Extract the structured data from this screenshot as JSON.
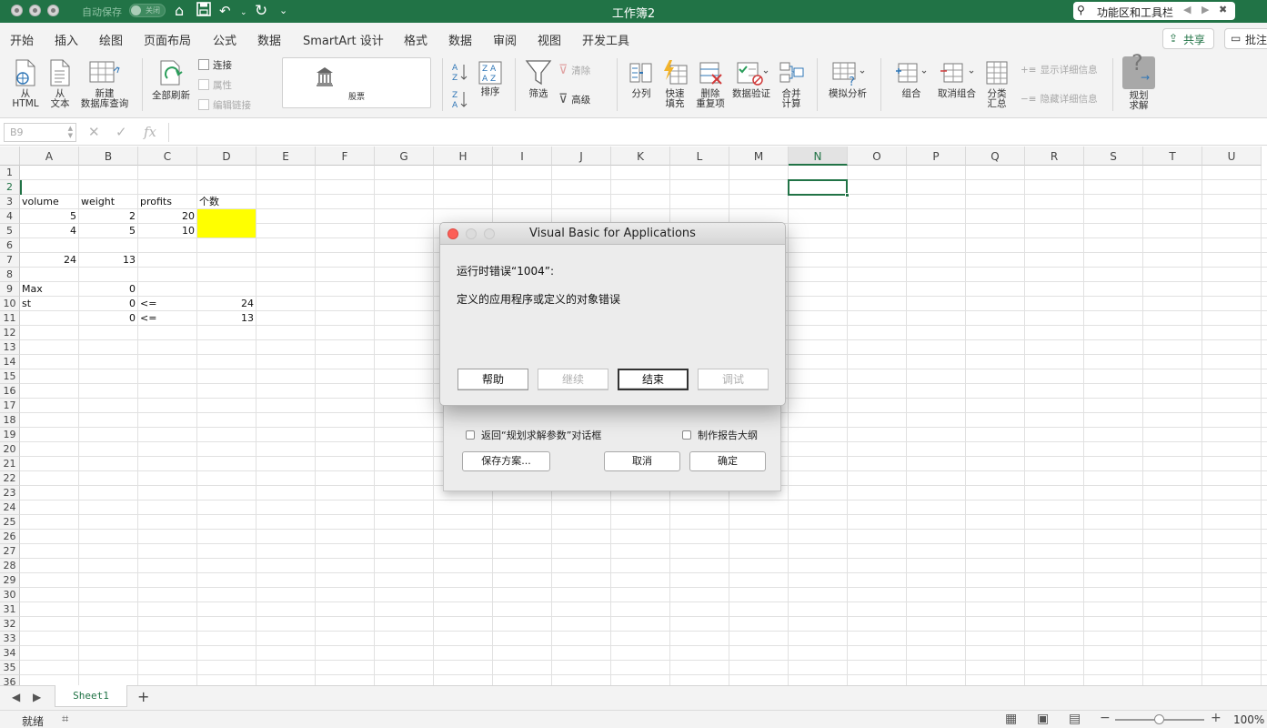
{
  "titlebar": {
    "autosave_label": "自动保存",
    "autosave_state": "关闭",
    "title": "工作簿2",
    "search_query": "功能区和工具栏"
  },
  "ribbon_tabs": [
    "开始",
    "插入",
    "绘图",
    "页面布局",
    "公式",
    "数据",
    "SmartArt 设计",
    "格式",
    "数据",
    "审阅",
    "视图",
    "开发工具"
  ],
  "active_tab_index": 5,
  "header_buttons": {
    "share": "共享",
    "comment": "批注"
  },
  "ribbon": {
    "from_html": [
      "从",
      "HTML"
    ],
    "from_text": [
      "从",
      "文本"
    ],
    "new_query": [
      "新建",
      "数据库查询"
    ],
    "refresh_all": "全部刷新",
    "connections": "连接",
    "properties": "属性",
    "edit_links": "编辑链接",
    "stocks": "股票",
    "sort": "排序",
    "filter": "筛选",
    "clear": "清除",
    "advanced": "高级",
    "text_to_columns": "分列",
    "flash_fill": [
      "快速",
      "填充"
    ],
    "remove_duplicates": [
      "删除",
      "重复项"
    ],
    "data_validation": "数据验证",
    "consolidate": [
      "合并",
      "计算"
    ],
    "what_if": "模拟分析",
    "group": "组合",
    "ungroup": "取消组合",
    "subtotal": [
      "分类",
      "汇总"
    ],
    "show_detail": "显示详细信息",
    "hide_detail": "隐藏详细信息",
    "solver": [
      "规划",
      "求解"
    ]
  },
  "formula_bar": {
    "name_box": "B9",
    "fx": "fx",
    "content": ""
  },
  "columns": [
    "A",
    "B",
    "C",
    "D",
    "E",
    "F",
    "G",
    "H",
    "I",
    "J",
    "K",
    "L",
    "M",
    "N",
    "O",
    "P",
    "Q",
    "R",
    "S",
    "T",
    "U"
  ],
  "selected_column": "N",
  "rows": [
    "1",
    "2",
    "3",
    "4",
    "5",
    "6",
    "7",
    "8",
    "9",
    "10",
    "11",
    "12",
    "13",
    "14",
    "15",
    "16",
    "17",
    "18",
    "19",
    "20",
    "21",
    "22",
    "23",
    "24",
    "25",
    "26",
    "27",
    "28",
    "29",
    "30",
    "31",
    "32",
    "33",
    "34",
    "35",
    "36"
  ],
  "selected_row": "2",
  "cells": {
    "A3": "volume",
    "B3": "weight",
    "C3": "profits",
    "D3": "个数",
    "A4": "5",
    "B4": "2",
    "C4": "20",
    "A5": "4",
    "B5": "5",
    "C5": "10",
    "A7": "24",
    "B7": "13",
    "A9": "Max",
    "B9": "0",
    "A10": "st",
    "B10": "0",
    "C10": "<=",
    "D10": "24",
    "B11": "0",
    "C11": "<=",
    "D11": "13"
  },
  "highlight_color": "#ffff00",
  "accent_color": "#217346",
  "sheet_tabs": [
    "Sheet1"
  ],
  "status": {
    "mode": "就绪",
    "zoom": "100%"
  },
  "solver_dialog": {
    "return_checkbox": "返回“规划求解参数”对话框",
    "outline_checkbox": "制作报告大纲",
    "save_scenario": "保存方案...",
    "cancel": "取消",
    "ok": "确定"
  },
  "vba_dialog": {
    "title": "Visual Basic for Applications",
    "error_line": "运行时错误“1004”:",
    "message": "定义的应用程序或定义的对象错误",
    "buttons": {
      "help": "帮助",
      "continue": "继续",
      "end": "结束",
      "debug": "调试"
    }
  }
}
